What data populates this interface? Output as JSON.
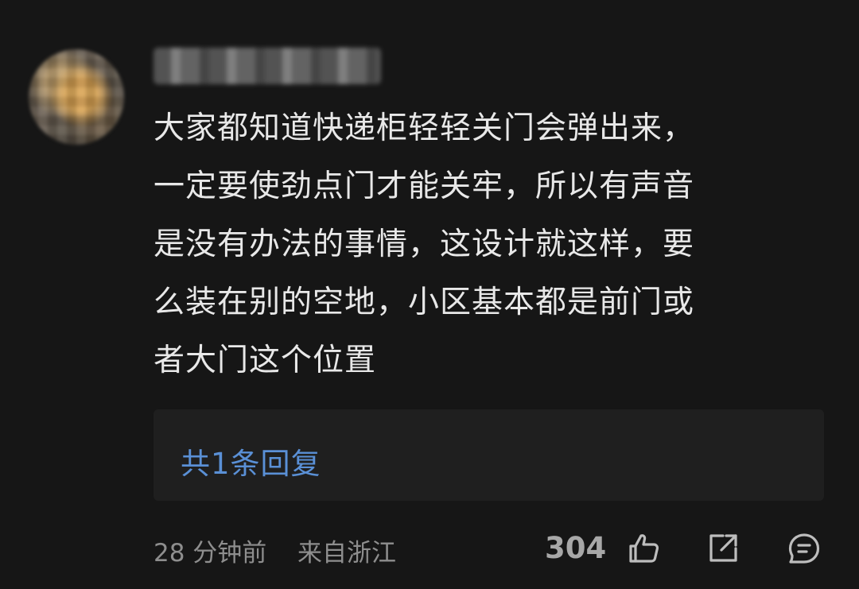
{
  "comment": {
    "lines": [
      "大家都知道快递柜轻轻关门会弹出来，",
      "一定要使劲点门才能关牢，所以有声音",
      "是没有办法的事情，这设计就这样，要",
      "么装在别的空地，小区基本都是前门或",
      "者大门这个位置"
    ]
  },
  "replies": {
    "label": "共1条回复"
  },
  "footer": {
    "time": "28 分钟前",
    "location": "来自浙江",
    "like_count": "304"
  },
  "icons": {
    "like": "thumbs-up-icon",
    "share": "share-icon",
    "reply": "comment-icon"
  },
  "colors": {
    "background": "#161616",
    "replies_background": "#1f1f1f",
    "link": "#5a90d6",
    "text": "#e8e8e8",
    "meta": "#8e8e8e"
  }
}
